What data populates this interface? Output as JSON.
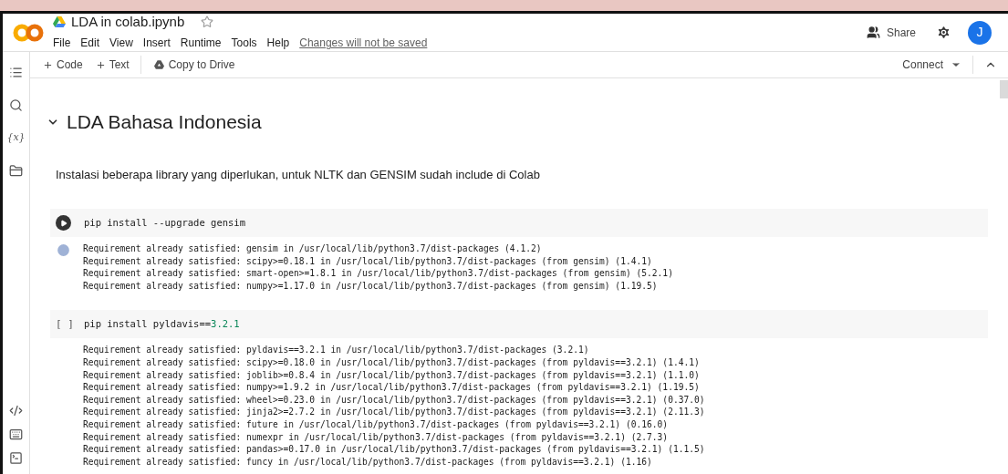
{
  "header": {
    "title": "LDA in colab.ipynb",
    "starred": false,
    "menu": [
      "File",
      "Edit",
      "View",
      "Insert",
      "Runtime",
      "Tools",
      "Help"
    ],
    "save_notice": "Changes will not be saved",
    "share": "Share",
    "avatar": "J"
  },
  "toolbar": {
    "add": [
      "Code",
      "Text"
    ],
    "copy": "Copy to Drive",
    "connect": "Connect"
  },
  "sidebar": {
    "variables_label": "{x}"
  },
  "cells": [
    {
      "kind": "heading",
      "text": "LDA Bahasa Indonesia",
      "expanded": true
    },
    {
      "kind": "text",
      "text": "Instalasi beberapa library yang diperlukan, untuk NLTK dan GENSIM sudah include di Colab"
    },
    {
      "kind": "code",
      "executed": true,
      "code": [
        {
          "kind": "plain",
          "text": "pip install --upgrade gensim"
        }
      ],
      "output": [
        "Requirement already satisfied: gensim in /usr/local/lib/python3.7/dist-packages (4.1.2)",
        "Requirement already satisfied: scipy>=0.18.1 in /usr/local/lib/python3.7/dist-packages (from gensim) (1.4.1)",
        "Requirement already satisfied: smart-open>=1.8.1 in /usr/local/lib/python3.7/dist-packages (from gensim) (5.2.1)",
        "Requirement already satisfied: numpy>=1.17.0 in /usr/local/lib/python3.7/dist-packages (from gensim) (1.19.5)"
      ]
    },
    {
      "kind": "code",
      "executed": false,
      "run_label": "[ ]",
      "code": [
        {
          "kind": "plain",
          "text": "pip install pyldavis=="
        },
        {
          "kind": "number",
          "text": "3.2.1"
        }
      ],
      "output": [
        "Requirement already satisfied: pyldavis==3.2.1 in /usr/local/lib/python3.7/dist-packages (3.2.1)",
        "Requirement already satisfied: scipy>=0.18.0 in /usr/local/lib/python3.7/dist-packages (from pyldavis==3.2.1) (1.4.1)",
        "Requirement already satisfied: joblib>=0.8.4 in /usr/local/lib/python3.7/dist-packages (from pyldavis==3.2.1) (1.1.0)",
        "Requirement already satisfied: numpy>=1.9.2 in /usr/local/lib/python3.7/dist-packages (from pyldavis==3.2.1) (1.19.5)",
        "Requirement already satisfied: wheel>=0.23.0 in /usr/local/lib/python3.7/dist-packages (from pyldavis==3.2.1) (0.37.0)",
        "Requirement already satisfied: jinja2>=2.7.2 in /usr/local/lib/python3.7/dist-packages (from pyldavis==3.2.1) (2.11.3)",
        "Requirement already satisfied: future in /usr/local/lib/python3.7/dist-packages (from pyldavis==3.2.1) (0.16.0)",
        "Requirement already satisfied: numexpr in /usr/local/lib/python3.7/dist-packages (from pyldavis==3.2.1) (2.7.3)",
        "Requirement already satisfied: pandas>=0.17.0 in /usr/local/lib/python3.7/dist-packages (from pyldavis==3.2.1) (1.1.5)",
        "Requirement already satisfied: funcy in /usr/local/lib/python3.7/dist-packages (from pyldavis==3.2.1) (1.16)"
      ]
    }
  ]
}
